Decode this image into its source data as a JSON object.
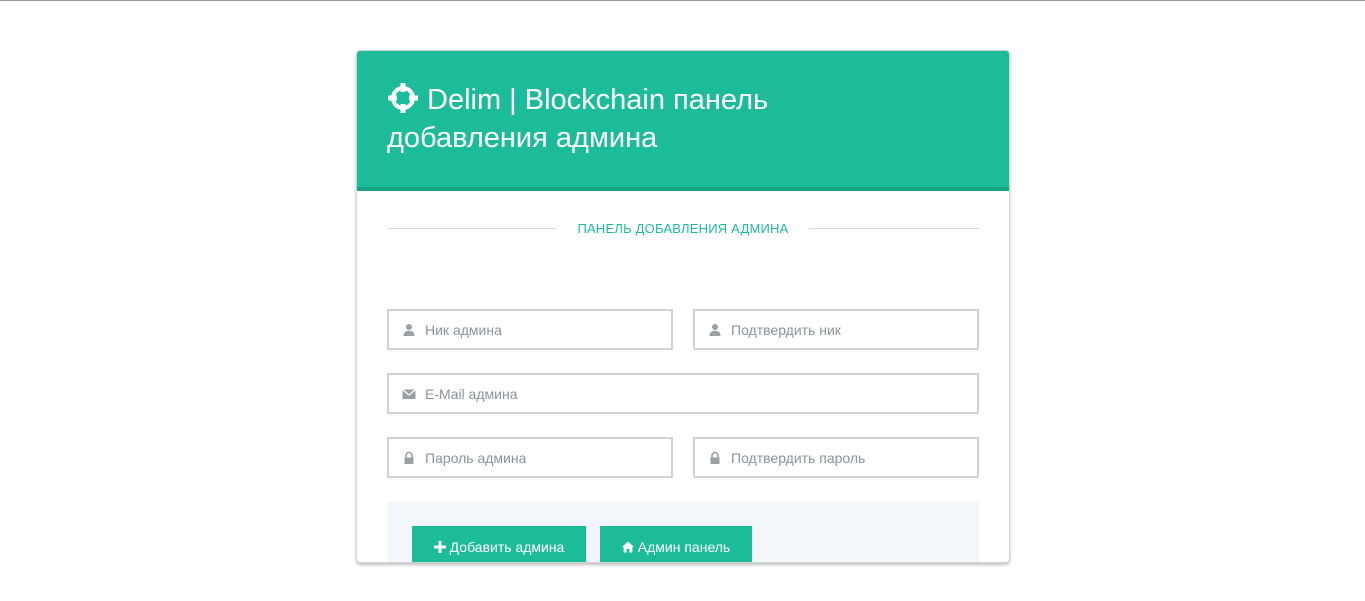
{
  "header": {
    "title": "Delim | Blockchain панель добавления админа",
    "icon": "crosshairs-icon",
    "background_color": "#1cbc9b"
  },
  "section": {
    "label": "ПАНЕЛЬ ДОБАВЛЕНИЯ АДМИНА"
  },
  "form": {
    "nick": {
      "placeholder": "Ник админа",
      "value": "",
      "icon": "user-icon"
    },
    "nick_confirm": {
      "placeholder": "Подтвердить ник",
      "value": "",
      "icon": "user-icon"
    },
    "email": {
      "placeholder": "E-Mail админа",
      "value": "",
      "icon": "envelope-icon"
    },
    "password": {
      "placeholder": "Пароль админа",
      "value": "",
      "icon": "lock-icon"
    },
    "password_confirm": {
      "placeholder": "Подтвердить пароль",
      "value": "",
      "icon": "lock-icon"
    }
  },
  "actions": {
    "add_admin_label": "Добавить админа",
    "add_admin_icon": "plus-icon",
    "admin_panel_label": "Админ панель",
    "admin_panel_icon": "home-icon"
  }
}
